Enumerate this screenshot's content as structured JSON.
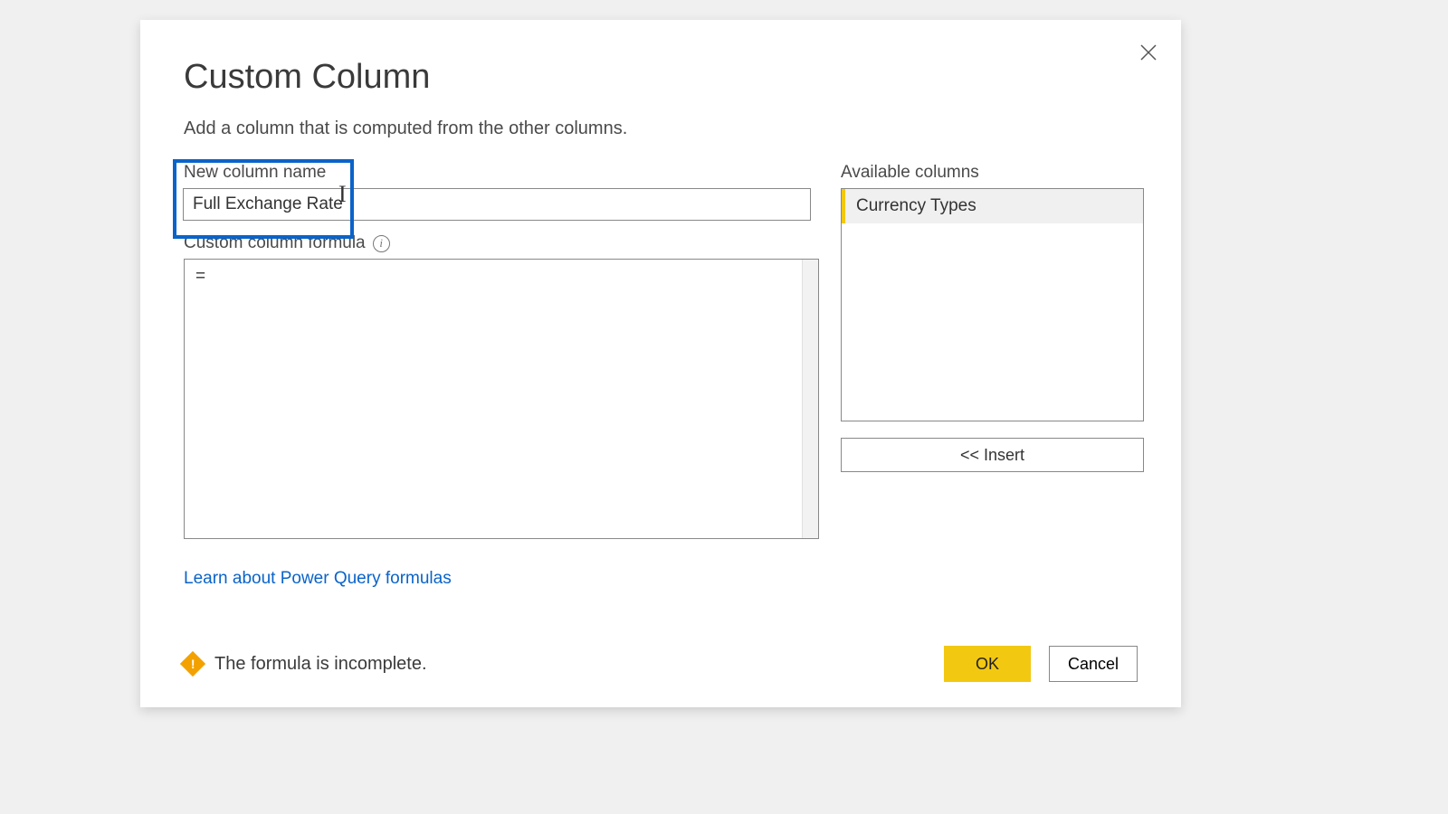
{
  "dialog": {
    "title": "Custom Column",
    "subtitle": "Add a column that is computed from the other columns."
  },
  "fields": {
    "column_name_label": "New column name",
    "column_name_value": "Full Exchange Rate",
    "formula_label": "Custom column formula",
    "formula_value": "="
  },
  "available": {
    "label": "Available columns",
    "items": [
      "Currency Types"
    ],
    "insert_label": "<< Insert"
  },
  "link": {
    "learn_label": "Learn about Power Query formulas"
  },
  "status": {
    "message": "The formula is incomplete."
  },
  "buttons": {
    "ok": "OK",
    "cancel": "Cancel"
  }
}
